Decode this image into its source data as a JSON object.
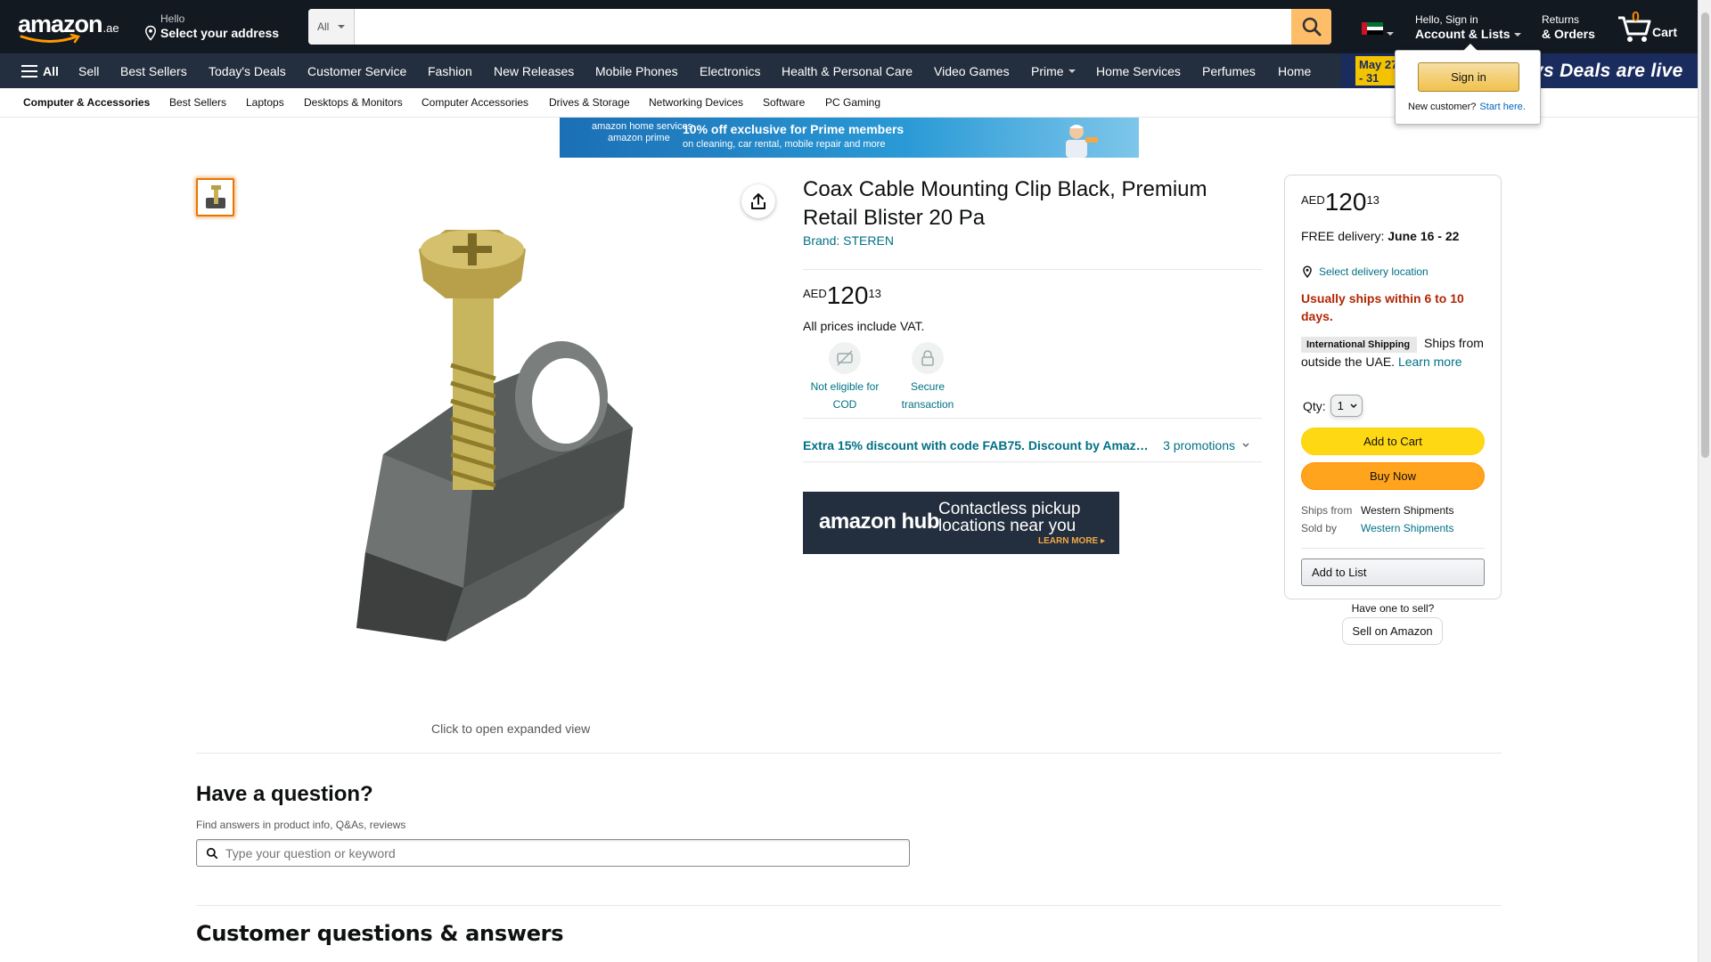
{
  "header": {
    "logo_word": "amazon",
    "logo_tld": ".ae",
    "address_small": "Hello",
    "address_big": "Select your address",
    "search_category": "All",
    "search_placeholder": "",
    "account_small": "Hello, Sign in",
    "account_big": "Account & Lists",
    "orders_small": "Returns",
    "orders_big": "& Orders",
    "cart_count": "0",
    "cart_label": "Cart"
  },
  "nav_main": {
    "all_label": "All",
    "items": [
      "Sell",
      "Best Sellers",
      "Today's Deals",
      "Customer Service",
      "Fashion",
      "New Releases",
      "Mobile Phones",
      "Electronics",
      "Health & Personal Care",
      "Video Games",
      "Prime",
      "Home Services",
      "Perfumes",
      "Home"
    ],
    "deals_date": "May 27 - 31",
    "deals_text": "ys  Deals are live"
  },
  "subnav": {
    "items": [
      "Computer & Accessories",
      "Best Sellers",
      "Laptops",
      "Desktops & Monitors",
      "Computer Accessories",
      "Drives & Storage",
      "Networking Devices",
      "Software",
      "PC Gaming"
    ]
  },
  "flyout": {
    "sign_in": "Sign in",
    "new_customer": "New customer?",
    "start_here": "Start here."
  },
  "promo_banner": {
    "brand_line1": "amazon home services",
    "brand_line2": "amazon prime",
    "line1": "10% off exclusive for Prime members",
    "line2": "on cleaning, car rental, mobile repair and more"
  },
  "product": {
    "title": "Coax Cable Mounting Clip Black, Premium Retail Blister 20 Pa",
    "brand": "Brand: STEREN",
    "price_symbol": "AED",
    "price_whole": "120",
    "price_fraction": "13",
    "vat_note": "All prices include VAT.",
    "features": [
      {
        "label": "Not eligible for COD",
        "icon": "no-cod-icon"
      },
      {
        "label": "Secure transaction",
        "icon": "lock-icon"
      }
    ],
    "promotion_text": "Extra 15% discount with code FAB75. Discount by Amaz…",
    "promotion_count": "3 promotions",
    "expand_text": "Click to open expanded view"
  },
  "hub_banner": {
    "brand": "amazon hub",
    "headline": "Contactless pickup locations near you",
    "cta": "LEARN MORE ▸"
  },
  "buybox": {
    "price_symbol": "AED",
    "price_whole": "120",
    "price_fraction": "13",
    "delivery_prefix": "FREE delivery:",
    "delivery_dates": "June 16 - 22",
    "location_link": "Select delivery location",
    "ships_warning": "Usually ships within 6 to 10 days.",
    "intl_tag": "International Shipping",
    "intl_text_1": "Ships from outside the UAE.",
    "intl_link": "Learn more",
    "qty_label": "Qty:",
    "qty_value": "1",
    "add_to_cart": "Add to Cart",
    "buy_now": "Buy Now",
    "ships_from_label": "Ships from",
    "ships_from_value": "Western Shipments",
    "sold_by_label": "Sold by",
    "sold_by_value": "Western Shipments",
    "add_to_list": "Add to List"
  },
  "sell": {
    "have_one": "Have one to sell?",
    "button": "Sell on Amazon"
  },
  "questions": {
    "title": "Have a question?",
    "subtitle": "Find answers in product info, Q&As, reviews",
    "placeholder": "Type your question or keyword",
    "cqa_title": "Customer questions & answers"
  },
  "colors": {
    "nav_dark": "#131921",
    "nav_secondary": "#232f3e",
    "search_button": "#febd69",
    "link": "#007185",
    "add_to_cart": "#ffd814",
    "buy_now": "#ffa41c",
    "warning": "#b12704",
    "cart_count": "#f08804"
  }
}
